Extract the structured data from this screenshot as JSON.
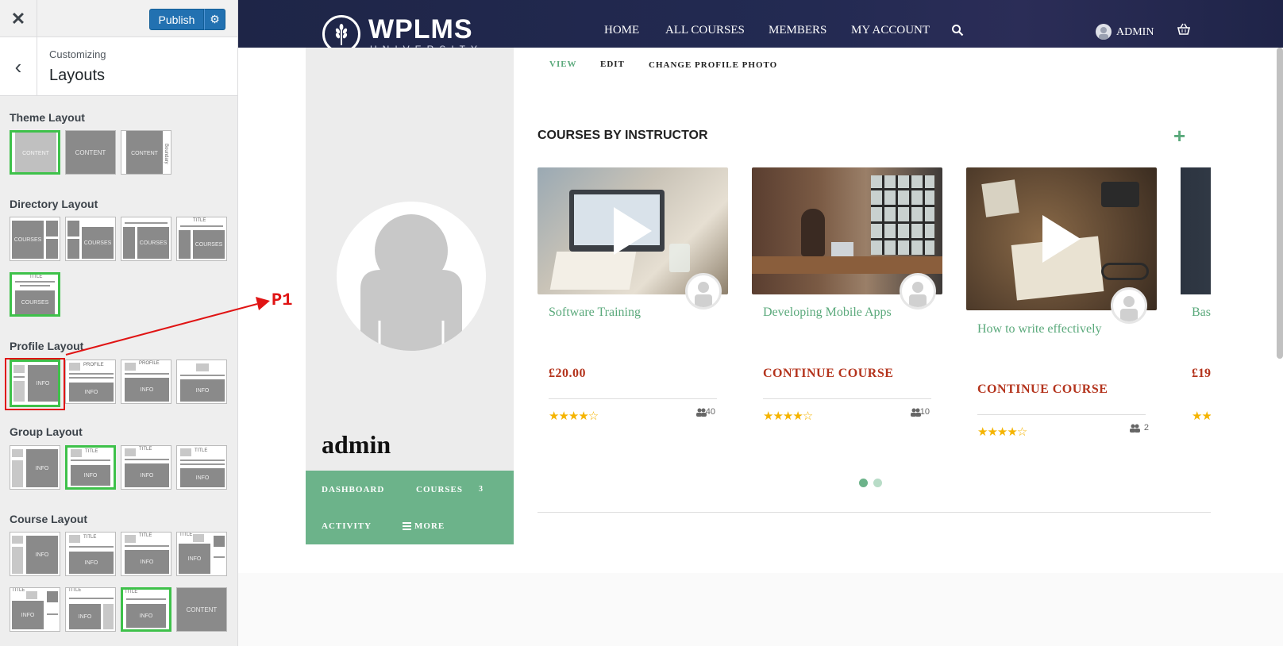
{
  "customizer": {
    "close_label": "✕",
    "publish_label": "Publish",
    "gear_label": "⚙",
    "back_label": "‹",
    "subtitle": "Customizing",
    "title": "Layouts",
    "sections": {
      "theme": "Theme Layout",
      "directory": "Directory Layout",
      "profile": "Profile Layout",
      "group": "Group Layout",
      "course": "Course Layout"
    },
    "thumb_labels": {
      "content": "CONTENT",
      "courses": "COURSES",
      "info": "INFO",
      "title": "TITLE",
      "profile": "PROFILE",
      "boundary": "Boundary"
    }
  },
  "annotation": {
    "label": "P1",
    "color": "#e01414"
  },
  "navbar": {
    "logo_text": "WPLMS",
    "logo_sub": "UNIVERSITY",
    "items": [
      "HOME",
      "ALL COURSES",
      "MEMBERS",
      "MY ACCOUNT"
    ],
    "user": "ADMIN"
  },
  "profile": {
    "tabs": [
      "VIEW",
      "EDIT",
      "CHANGE PROFILE PHOTO"
    ],
    "username": "admin",
    "menu": {
      "dashboard": "DASHBOARD",
      "courses": "COURSES",
      "courses_count": "3",
      "activity": "ACTIVITY",
      "more": "MORE"
    }
  },
  "courses_section": {
    "heading": "COURSES BY INSTRUCTOR",
    "add": "+",
    "cards": [
      {
        "title": "Software Training",
        "price": "£20.00",
        "rating": "★★★★☆",
        "students": "40"
      },
      {
        "title": "Developing Mobile Apps",
        "price": "CONTINUE  COURSE",
        "rating": "★★★★☆",
        "students": "10"
      },
      {
        "title": "How to write effectively",
        "price": "CONTINUE  COURSE",
        "rating": "★★★★☆",
        "students": "2"
      },
      {
        "title": "Bas",
        "price": "£19",
        "rating": "★★",
        "students": ""
      }
    ]
  },
  "colors": {
    "accent": "#6cb38a",
    "selected": "#3ec14a",
    "price": "#b4341d",
    "publish": "#2271b1",
    "nav_bg": "#1e2547"
  }
}
